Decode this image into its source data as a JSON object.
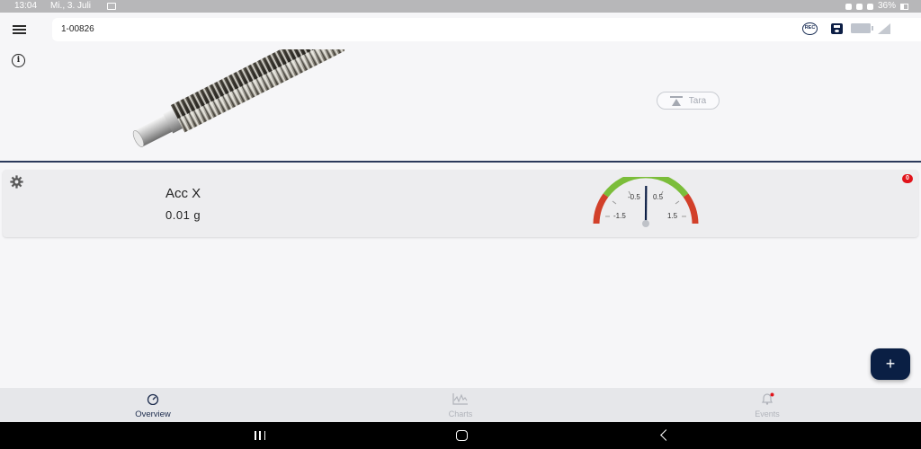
{
  "status_bar": {
    "time": "13:04",
    "date": "Mi., 3. Juli",
    "battery": "36%"
  },
  "header": {
    "device_id": "1-00826",
    "rec_label": "REC"
  },
  "tara": {
    "label": "Tara"
  },
  "sensor_card": {
    "name": "Acc X",
    "value": "0.01 g",
    "badge_count": "0",
    "gauge": {
      "labels": [
        "-1.5",
        "-0.5",
        "0.5",
        "1.5"
      ],
      "needle_value": 0.01,
      "min": -2,
      "max": 2,
      "colors": {
        "ok": "#7bbd3a",
        "warn": "#d2402a",
        "needle": "#0c1e45"
      }
    }
  },
  "fab": {
    "icon": "plus-icon",
    "label": "+"
  },
  "bottom_nav": {
    "items": [
      {
        "label": "Overview",
        "icon": "gauge-icon",
        "active": true
      },
      {
        "label": "Charts",
        "icon": "chart-icon",
        "active": false
      },
      {
        "label": "Events",
        "icon": "bell-icon",
        "active": false
      }
    ]
  },
  "colors": {
    "accent": "#0a1f44",
    "divider": "#2b3a5c",
    "badge": "#e1141b"
  }
}
